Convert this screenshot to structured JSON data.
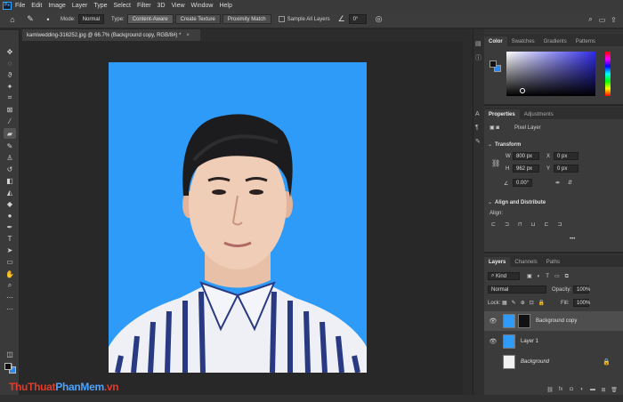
{
  "menu": {
    "logo": "Ps",
    "items": [
      "File",
      "Edit",
      "Image",
      "Layer",
      "Type",
      "Select",
      "Filter",
      "3D",
      "View",
      "Window",
      "Help"
    ]
  },
  "options": {
    "mode_label": "Mode:",
    "mode_value": "Normal",
    "type_label": "Type:",
    "btn_content_aware": "Content-Aware",
    "btn_create_texture": "Create Texture",
    "btn_proximity_match": "Proximity Match",
    "sample_all_layers": "Sample All Layers",
    "angle_value": "0°"
  },
  "document": {
    "tab_title": "kamiwedding-316252.jpg @ 66.7% (Background copy, RGB/8#) *",
    "close": "×"
  },
  "color_panel": {
    "tabs": [
      "Color",
      "Swatches",
      "Gradients",
      "Patterns"
    ],
    "fg_color": "#111111",
    "bg_color": "#2b87ef"
  },
  "properties_panel": {
    "tabs": [
      "Properties",
      "Adjustments"
    ],
    "layer_kind": "Pixel Layer",
    "transform_title": "Transform",
    "w_label": "W",
    "w_value": "800 px",
    "h_label": "H",
    "h_value": "962 px",
    "x_label": "X",
    "x_value": "0 px",
    "y_label": "Y",
    "y_value": "0 px",
    "angle_value": "0.00°",
    "align_title": "Align and Distribute",
    "align_label": "Align:",
    "more": "•••"
  },
  "layers_panel": {
    "tabs": [
      "Layers",
      "Channels",
      "Paths"
    ],
    "kind_label": "Kind",
    "blend_mode": "Normal",
    "opacity_label": "Opacity:",
    "opacity_value": "100%",
    "lock_label": "Lock:",
    "fill_label": "Fill:",
    "fill_value": "100%",
    "layers": [
      {
        "name": "Background copy",
        "visible": true,
        "selected": true
      },
      {
        "name": "Layer 1",
        "visible": true,
        "selected": false
      },
      {
        "name": "Background",
        "visible": false,
        "selected": false,
        "locked": true
      }
    ],
    "footer_fx": "fx"
  },
  "watermark": {
    "part1": "ThuThuat",
    "part2": "PhanMem",
    "part3": ".vn"
  },
  "canvas": {
    "background_color": "#2e9bf9"
  }
}
